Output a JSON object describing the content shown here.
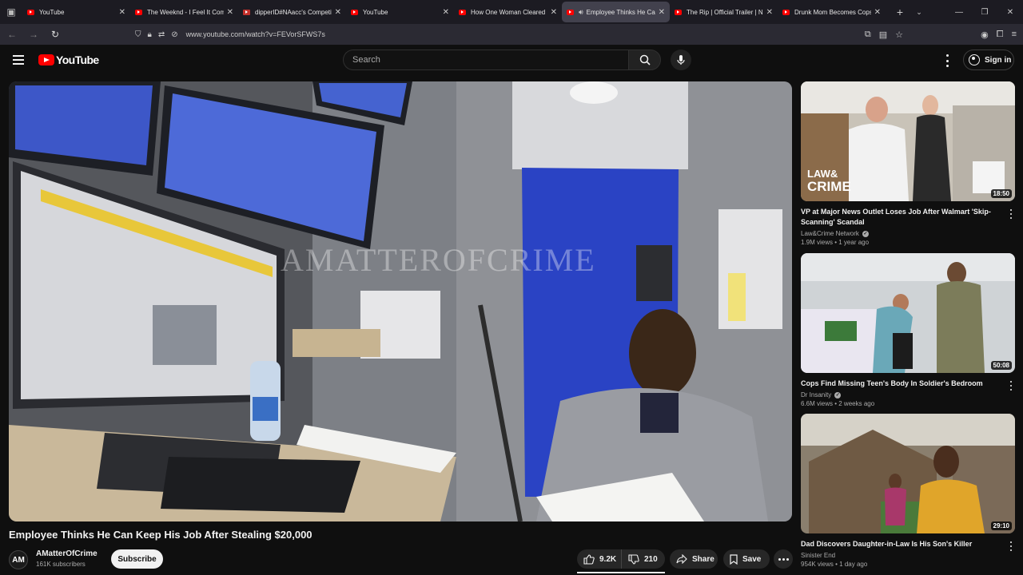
{
  "browser": {
    "tabs": [
      {
        "title": "YouTube",
        "favicon": "youtube-icon",
        "active": false
      },
      {
        "title": "The Weeknd - I Feel It Coming",
        "favicon": "youtube-icon",
        "active": false
      },
      {
        "title": "dipperID#NAacc's Competitive",
        "favicon": "game-site-icon",
        "active": false
      },
      {
        "title": "YouTube",
        "favicon": "youtube-icon",
        "active": false
      },
      {
        "title": "How One Woman Cleared Her",
        "favicon": "youtube-icon",
        "active": false
      },
      {
        "title": "Employee Thinks He Can",
        "favicon": "youtube-icon",
        "active": true,
        "audio": true
      },
      {
        "title": "The Rip | Official Trailer | Netflix",
        "favicon": "youtube-icon",
        "active": false
      },
      {
        "title": "Drunk Mom Becomes Cops'",
        "favicon": "youtube-icon",
        "active": false
      }
    ],
    "url": "www.youtube.com/watch?v=FEVorSFWS7s"
  },
  "header": {
    "logo_text": "YouTube",
    "search_placeholder": "Search",
    "signin_label": "Sign in"
  },
  "player": {
    "watermark": "AMATTEROFCRIME"
  },
  "video": {
    "title": "Employee Thinks He Can Keep His Job After Stealing $20,000",
    "channel": "AMatterOfCrime",
    "channel_initials": "AM",
    "subscribers": "161K subscribers",
    "subscribe_label": "Subscribe",
    "likes": "9.2K",
    "dislikes": "210",
    "share_label": "Share",
    "save_label": "Save"
  },
  "recommendations": [
    {
      "title": "VP at Major News Outlet Loses Job After Walmart 'Skip-Scanning' Scandal",
      "channel": "Law&Crime Network",
      "verified": true,
      "meta": "1.9M views • 1 year ago",
      "duration": "18:50",
      "thumb_logo_line1": "LAW&",
      "thumb_logo_line2": "CRIME"
    },
    {
      "title": "Cops Find Missing Teen's Body In Soldier's Bedroom",
      "channel": "Dr Insanity",
      "verified": true,
      "meta": "6.6M views • 2 weeks ago",
      "duration": "50:08"
    },
    {
      "title": "Dad Discovers Daughter-in-Law Is His Son's Killer",
      "channel": "Sinister End",
      "verified": false,
      "meta": "954K views • 1 day ago",
      "duration": "29:10"
    }
  ]
}
